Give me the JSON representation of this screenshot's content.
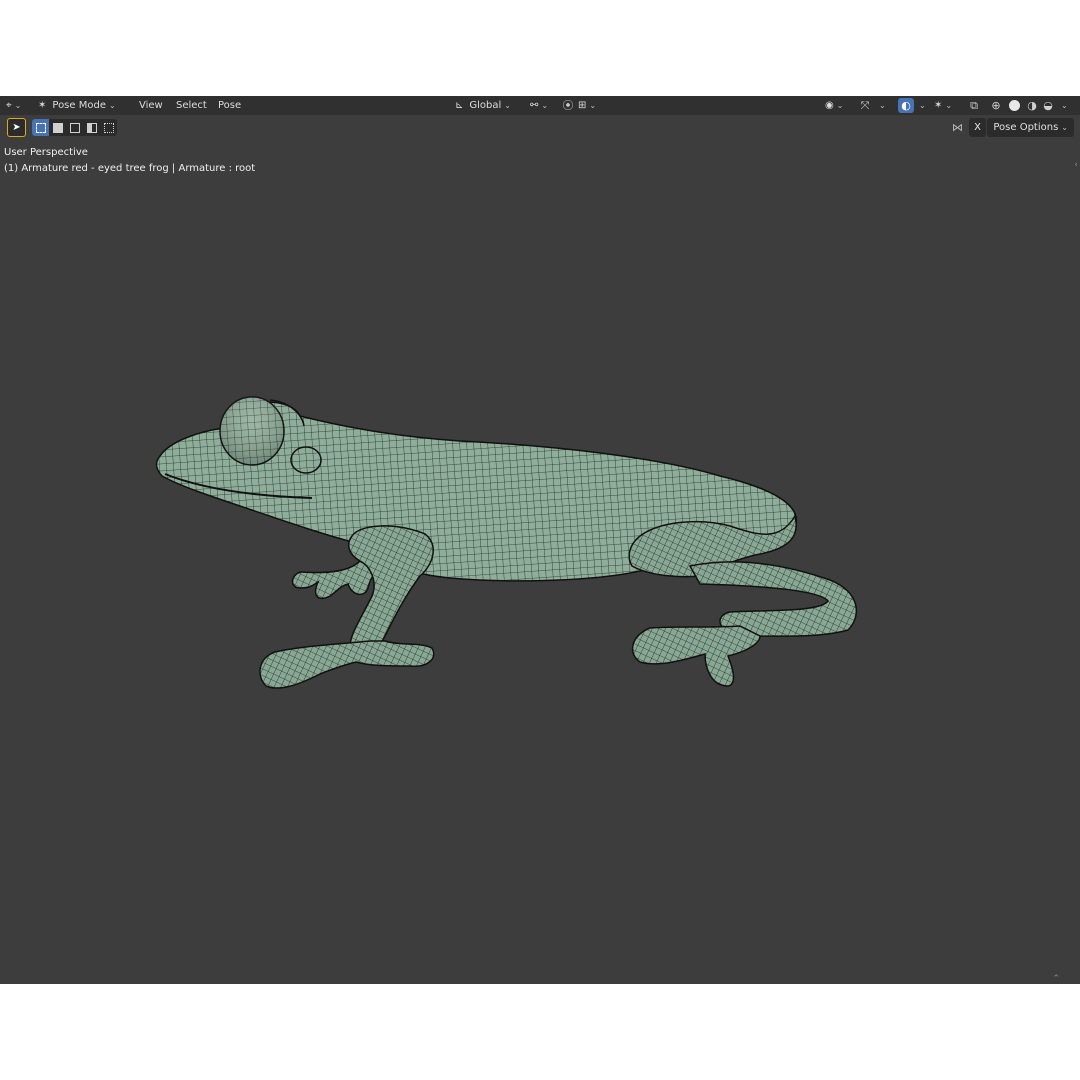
{
  "header": {
    "editor_type_icon": "editor-type-icon",
    "mode_label": "Pose Mode",
    "menus": [
      "View",
      "Select",
      "Pose"
    ],
    "transform_orientation": "Global"
  },
  "toolbar": {
    "pose_options_label": "Pose Options",
    "x_mirror_label": "X"
  },
  "viewport": {
    "view_label": "User Perspective",
    "object_info": "(1) Armature red - eyed tree frog | Armature : root",
    "mesh_color": "#8fae9a",
    "wire_color": "#1c2a22",
    "background_color": "#3d3d3d"
  }
}
